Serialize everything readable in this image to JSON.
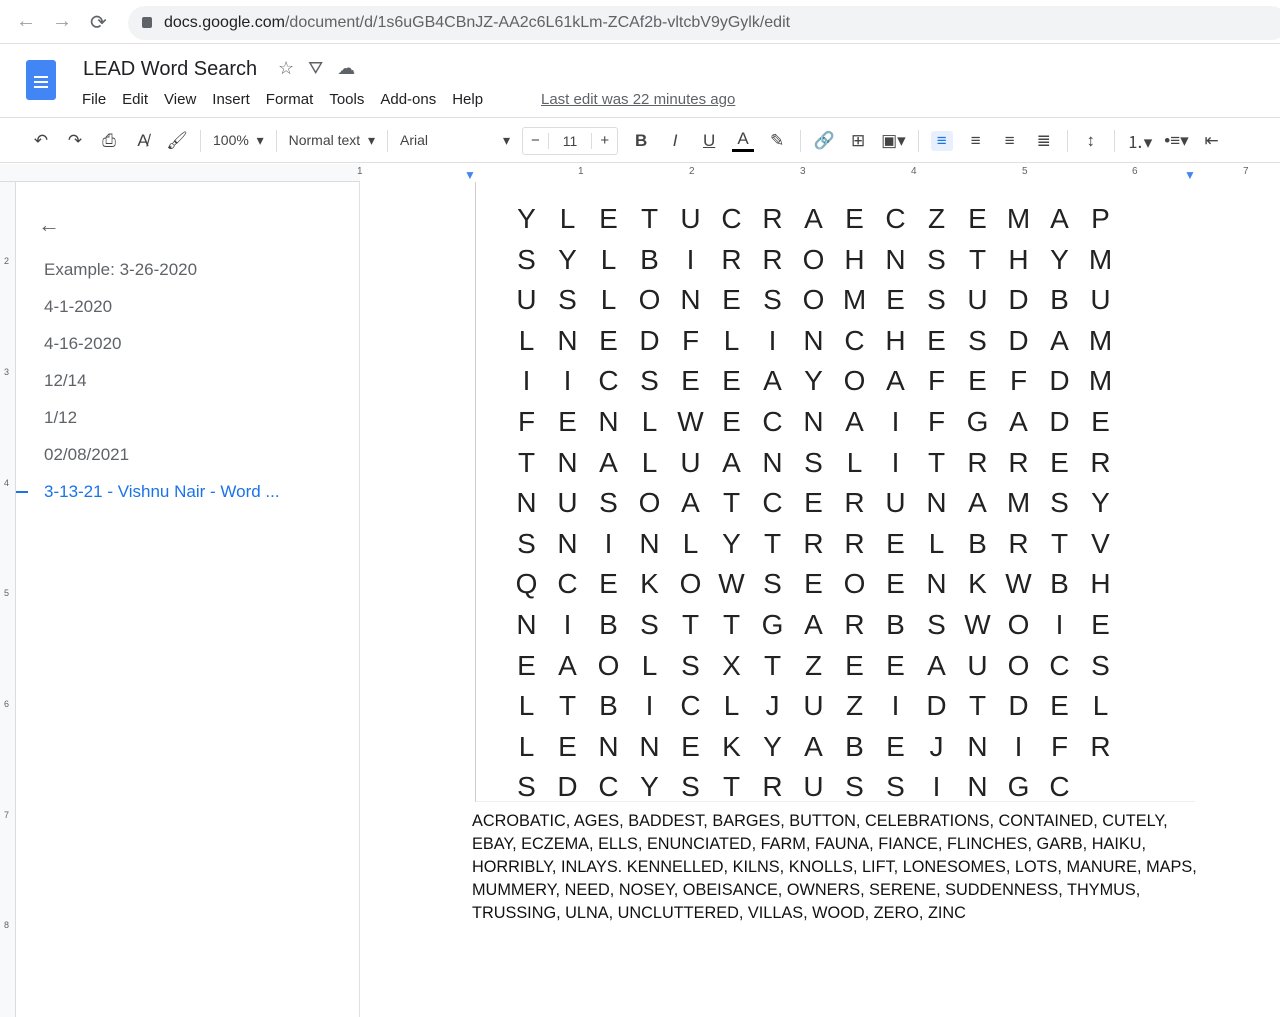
{
  "browser": {
    "url_host": "docs.google.com",
    "url_path": "/document/d/1s6uGB4CBnJZ-AA2c6L61kLm-ZCAf2b-vltcbV9yGylk/edit"
  },
  "doc": {
    "title": "LEAD Word Search",
    "last_edit": "Last edit was 22 minutes ago"
  },
  "menu": [
    "File",
    "Edit",
    "View",
    "Insert",
    "Format",
    "Tools",
    "Add-ons",
    "Help"
  ],
  "toolbar": {
    "zoom": "100%",
    "style": "Normal text",
    "font": "Arial",
    "font_size": "11"
  },
  "ruler": [
    "1",
    "1",
    "2",
    "3",
    "4",
    "5",
    "6",
    "7"
  ],
  "vruler": [
    "2",
    "3",
    "4",
    "5",
    "6",
    "7",
    "8"
  ],
  "outline": {
    "items": [
      "Example: 3-26-2020",
      "4-1-2020",
      "4-16-2020",
      "12/14",
      "1/12",
      "02/08/2021",
      "3-13-21 - Vishnu Nair - Word ..."
    ],
    "selected": 6
  },
  "grid": [
    "YLETUCRAECZEMAPS",
    "YLBIRROHNSTHYMUS",
    "LONESOMESUDBULNE",
    "DFLINCHESDAMIICS",
    "EEAYOAFEFDMFENLW",
    "ECNAIFGADETNALUA",
    "NSLITRRERNUSOATC",
    "ERUNAMSYSNINLYTR",
    "RELBRTVQCEKOWSEO",
    "ENKWBHNIBSTTGARB",
    "SWOIEEAOLSXTZEEA",
    "UOCSLTBICLJUZIDT",
    "DELLENNEKYABEJNI",
    "FRSDCYSTRUSSINGC"
  ],
  "word_list": "ACROBATIC, AGES, BADDEST, BARGES, BUTTON, CELEBRATIONS, CONTAINED, CUTELY, EBAY, ECZEMA, ELLS, ENUNCIATED, FARM, FAUNA, FIANCE, FLINCHES, GARB, HAIKU, HORRIBLY, INLAYS. KENNELLED, KILNS, KNOLLS, LIFT, LONESOMES, LOTS, MANURE, MAPS, MUMMERY, NEED, NOSEY, OBEISANCE, OWNERS, SERENE, SUDDENNESS, THYMUS, TRUSSING, ULNA, UNCLUTTERED, VILLAS, WOOD, ZERO, ZINC"
}
